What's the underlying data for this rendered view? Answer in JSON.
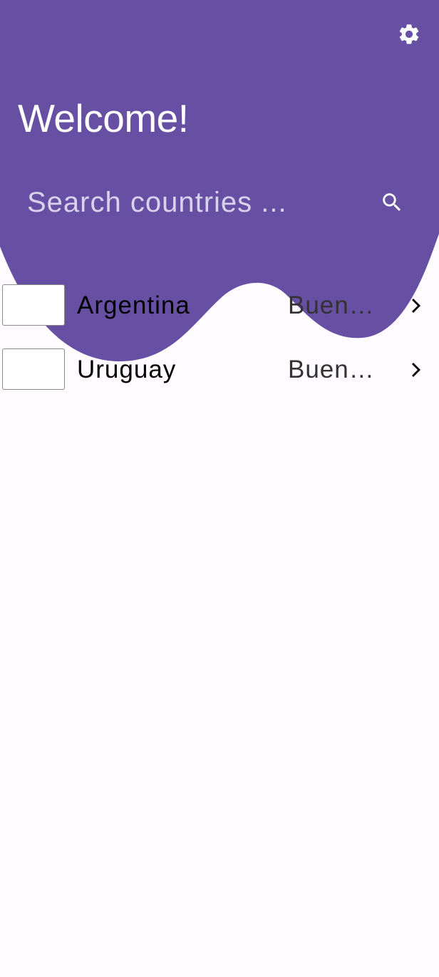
{
  "colors": {
    "header_bg": "#6750a4",
    "page_bg": "#fffbfe",
    "header_text": "#ffffff",
    "placeholder": "#d8d2ec"
  },
  "header": {
    "title": "Welcome!",
    "settings_icon": "gear-icon"
  },
  "search": {
    "placeholder": "Search countries ...",
    "value": "",
    "icon": "search-icon"
  },
  "countries": [
    {
      "name": "Argentina",
      "capital": "Buenos Aires",
      "flag": "",
      "chevron_icon": "chevron-right-icon"
    },
    {
      "name": "Uruguay",
      "capital": "Buenos Aires",
      "flag": "",
      "chevron_icon": "chevron-right-icon"
    }
  ]
}
